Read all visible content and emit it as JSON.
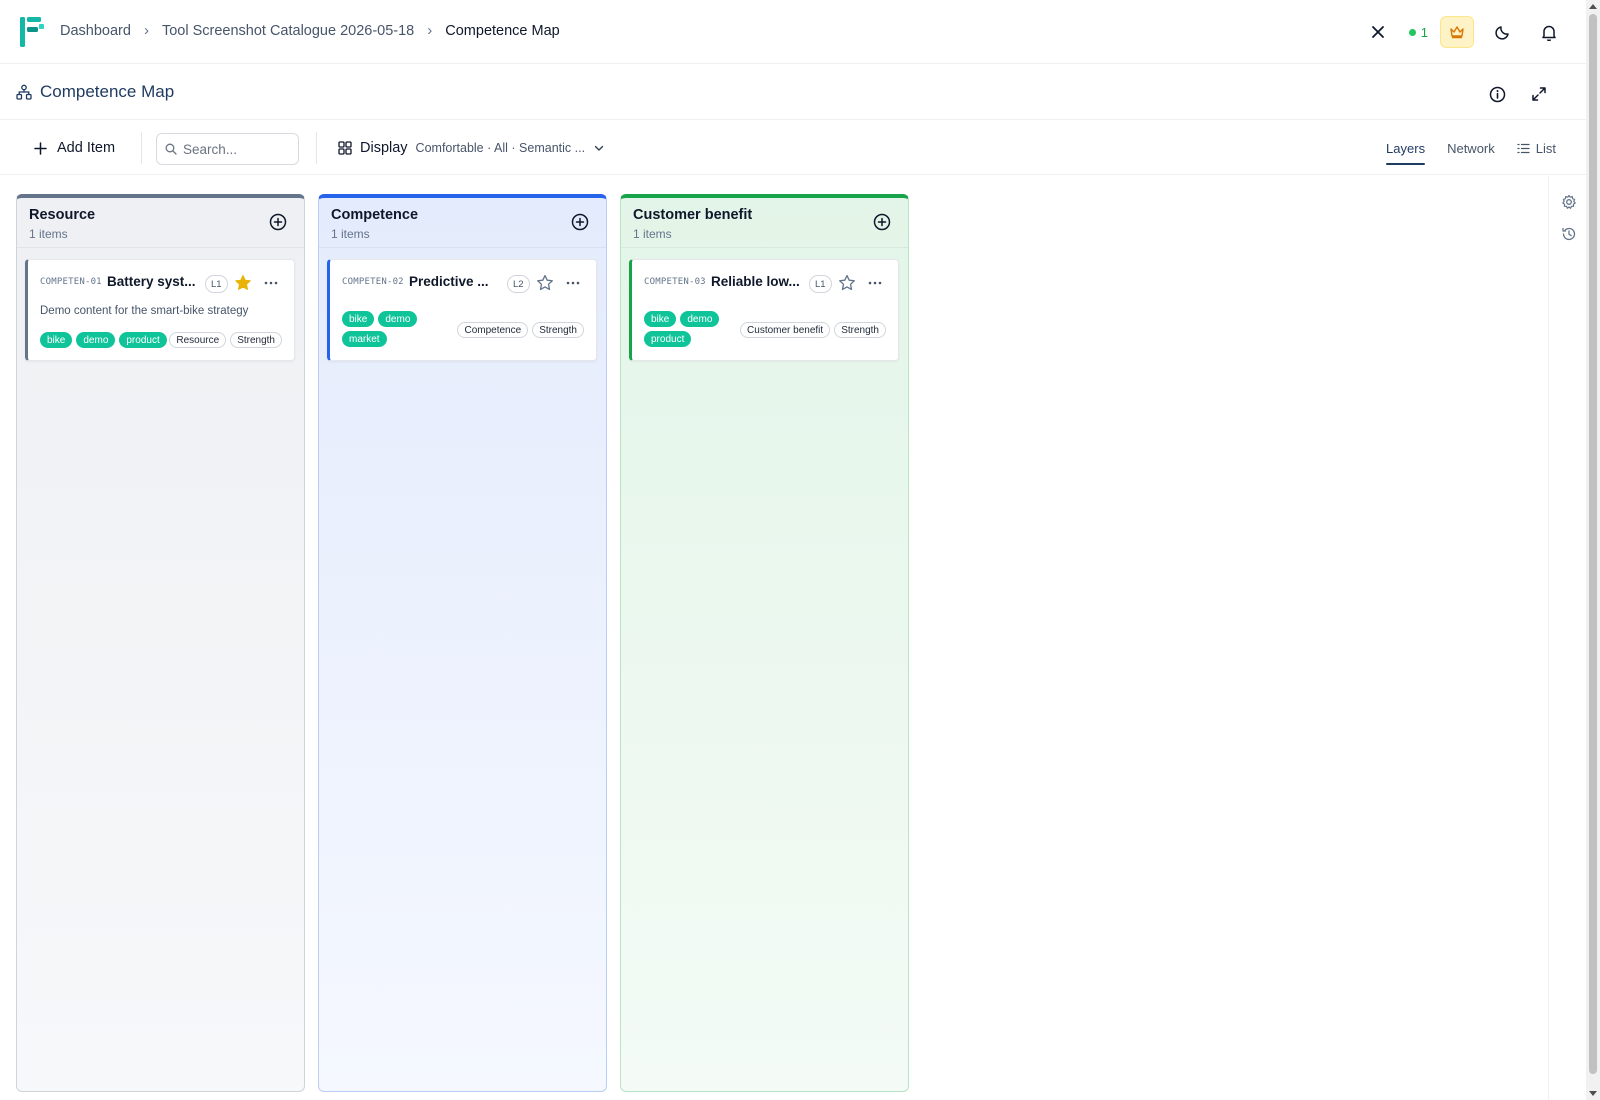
{
  "breadcrumb": [
    "Dashboard",
    "Tool Screenshot Catalogue 2026-05-18",
    "Competence Map"
  ],
  "presence_count": "1",
  "page": {
    "title": "Competence Map"
  },
  "toolbar": {
    "add_label": "Add Item",
    "search_placeholder": "Search...",
    "display_label": "Display",
    "display_summary": "Comfortable · All · Semantic ..."
  },
  "views": {
    "layers": "Layers",
    "network": "Network",
    "list": "List",
    "active": "Layers"
  },
  "colors": {
    "resource": "#64748b",
    "competence": "#2563eb",
    "customer_benefit": "#16a34a",
    "tag": "#10c49a",
    "star": "#eab308"
  },
  "columns": [
    {
      "title": "Resource",
      "count": "1 items",
      "card": {
        "code": "COMPETEN-01",
        "name": "Battery syst...",
        "level": "L1",
        "starred": true,
        "description": "Demo content for the smart-bike strategy workspace, written to make the tool state",
        "tags": [
          "bike",
          "demo",
          "product"
        ],
        "chips": [
          "Resource",
          "Strength"
        ]
      }
    },
    {
      "title": "Competence",
      "count": "1 items",
      "card": {
        "code": "COMPETEN-02",
        "name": "Predictive ...",
        "level": "L2",
        "starred": false,
        "tags": [
          "bike",
          "demo",
          "market"
        ],
        "chips": [
          "Competence",
          "Strength"
        ]
      }
    },
    {
      "title": "Customer benefit",
      "count": "1 items",
      "card": {
        "code": "COMPETEN-03",
        "name": "Reliable low...",
        "level": "L1",
        "starred": false,
        "tags": [
          "bike",
          "demo",
          "product"
        ],
        "chips": [
          "Customer benefit",
          "Strength"
        ]
      }
    }
  ]
}
